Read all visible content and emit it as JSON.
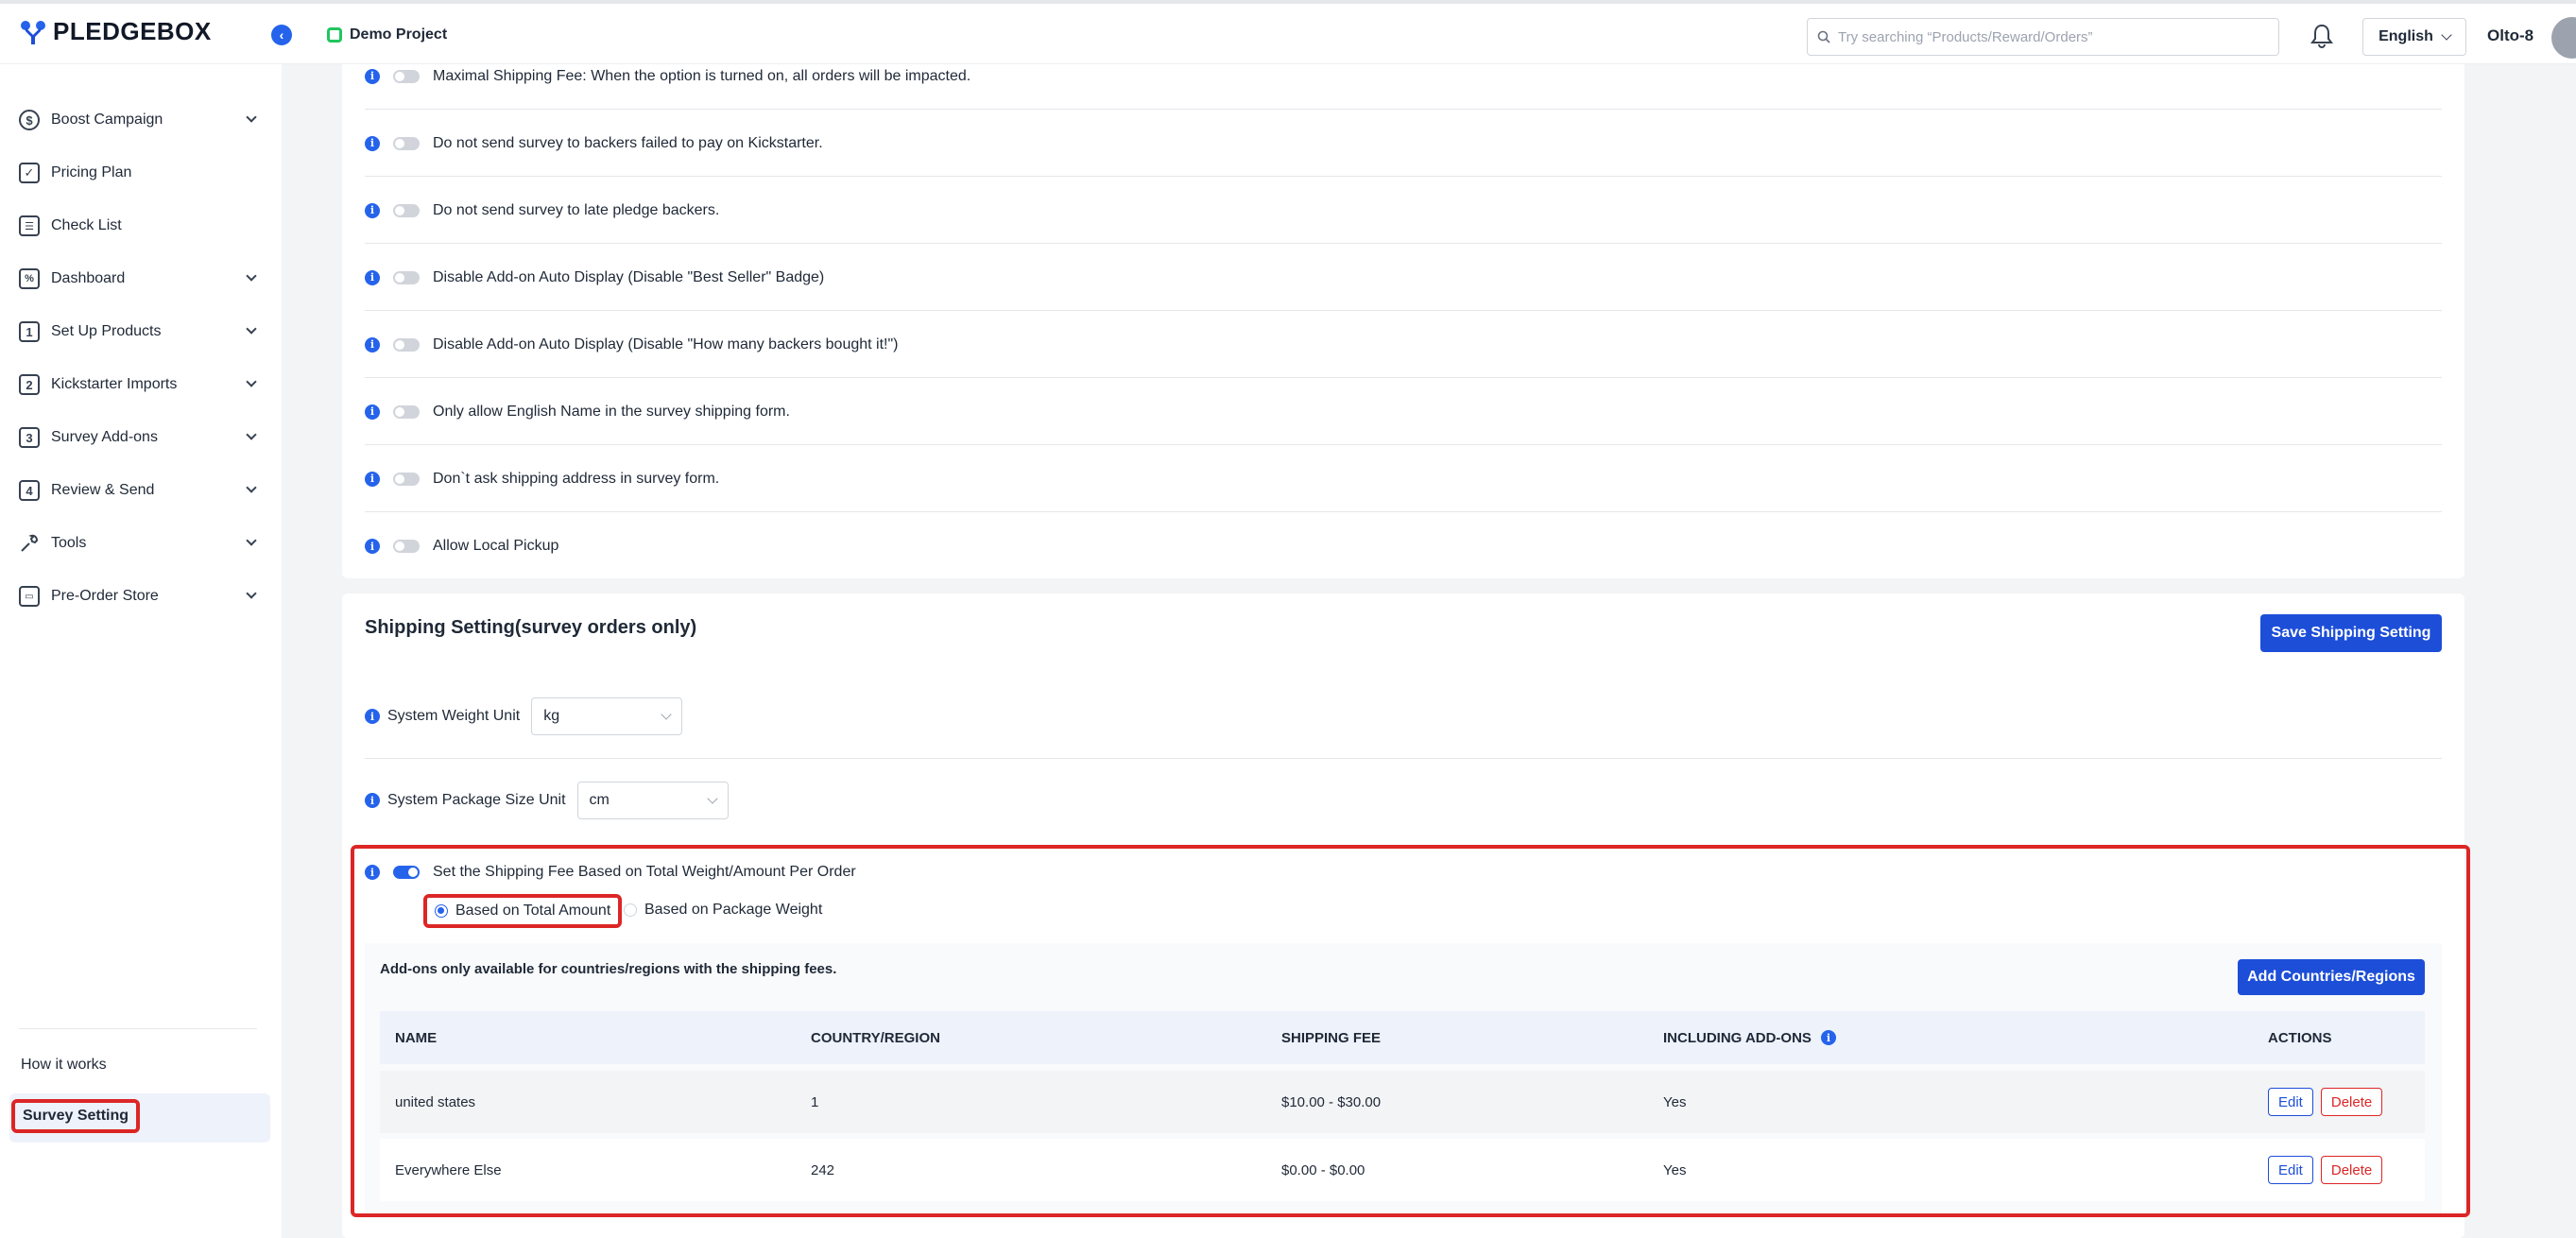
{
  "app": {
    "brand": "PLEDGEBOX",
    "project": "Demo Project",
    "search_placeholder": "Try searching “Products/Reward/Orders”",
    "language": "English",
    "user": "Olto-8"
  },
  "sidebar": {
    "items": [
      {
        "label": "Boost Campaign",
        "icon": "dollar-circle-icon",
        "has_children": true
      },
      {
        "label": "Pricing Plan",
        "icon": "calendar-icon",
        "has_children": false
      },
      {
        "label": "Check List",
        "icon": "checklist-icon",
        "has_children": false
      },
      {
        "label": "Dashboard",
        "icon": "chart-icon",
        "has_children": true
      },
      {
        "label": "Set Up Products",
        "icon": "step-1-icon",
        "has_children": true
      },
      {
        "label": "Kickstarter Imports",
        "icon": "step-2-icon",
        "has_children": true
      },
      {
        "label": "Survey Add-ons",
        "icon": "step-3-icon",
        "has_children": true
      },
      {
        "label": "Review & Send",
        "icon": "step-4-icon",
        "has_children": true
      },
      {
        "label": "Tools",
        "icon": "wrench-icon",
        "has_children": true
      },
      {
        "label": "Pre-Order Store",
        "icon": "store-icon",
        "has_children": true
      }
    ],
    "step_numbers": [
      "1",
      "2",
      "3",
      "4"
    ],
    "how_it_works": "How it works",
    "survey_setting": "Survey Setting"
  },
  "options": [
    {
      "label": "Maximal Shipping Fee: When the option is turned on, all orders will be impacted.",
      "on": false
    },
    {
      "label": "Do not send survey to backers failed to pay on Kickstarter.",
      "on": false
    },
    {
      "label": "Do not send survey to late pledge backers.",
      "on": false
    },
    {
      "label": "Disable Add-on Auto Display (Disable \"Best Seller\" Badge)",
      "on": false
    },
    {
      "label": "Disable Add-on Auto Display (Disable \"How many backers bought it!\")",
      "on": false
    },
    {
      "label": "Only allow English Name in the survey shipping form.",
      "on": false
    },
    {
      "label": "Don`t ask shipping address in survey form.",
      "on": false
    },
    {
      "label": "Allow Local Pickup",
      "on": false
    }
  ],
  "shipping": {
    "title": "Shipping Setting(survey orders only)",
    "save_label": "Save Shipping Setting",
    "weight_unit_label": "System Weight Unit",
    "weight_unit_value": "kg",
    "package_unit_label": "System Package Size Unit",
    "package_unit_value": "cm",
    "fee_toggle_label": "Set the Shipping Fee Based on Total Weight/Amount Per Order",
    "fee_toggle_on": true,
    "radio_total": "Based on Total Amount",
    "radio_weight": "Based on Package Weight",
    "addons_note": "Add-ons only available for countries/regions with the shipping fees.",
    "add_countries_label": "Add Countries/Regions",
    "columns": [
      "NAME",
      "COUNTRY/REGION",
      "SHIPPING FEE",
      "INCLUDING ADD-ONS",
      "ACTIONS"
    ],
    "rows": [
      {
        "name": "united states",
        "country": "1",
        "fee": "$10.00 - $30.00",
        "addons": "Yes"
      },
      {
        "name": "Everywhere Else",
        "country": "242",
        "fee": "$0.00 - $0.00",
        "addons": "Yes"
      }
    ],
    "edit_label": "Edit",
    "delete_label": "Delete"
  },
  "colors": {
    "primary": "#1d4ed8",
    "danger": "#dc2626",
    "success": "#22c55e"
  }
}
